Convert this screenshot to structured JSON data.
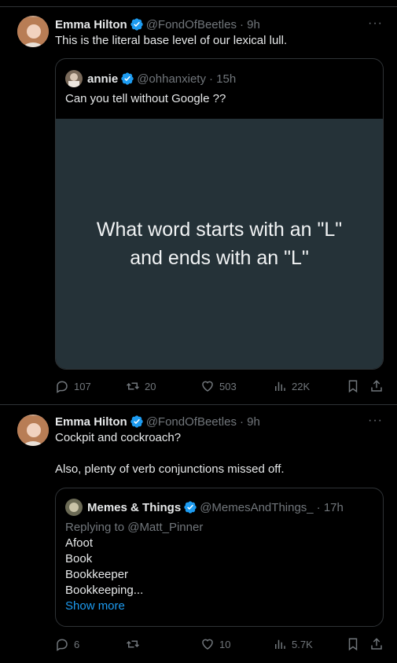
{
  "tweets": [
    {
      "author": {
        "name": "Emma Hilton",
        "handle": "@FondOfBeetles",
        "time": "· 9h"
      },
      "text": "This is the literal base level of our lexical lull.",
      "quote": {
        "author": {
          "name": "annie",
          "handle": "@ohhanxiety",
          "time": "· 15h"
        },
        "text": "Can you tell without Google ??",
        "media_text": "What word starts with an \"L\" and ends with an \"L\""
      },
      "actions": {
        "replies": "107",
        "reposts": "20",
        "likes": "503",
        "views": "22K"
      }
    },
    {
      "author": {
        "name": "Emma Hilton",
        "handle": "@FondOfBeetles",
        "time": "· 9h"
      },
      "text": "Cockpit and cockroach?\n\nAlso, plenty of verb conjunctions missed off.",
      "quote": {
        "author": {
          "name": "Memes & Things",
          "handle": "@MemesAndThings_",
          "time": "· 17h"
        },
        "replying_to": "Replying to @Matt_Pinner",
        "lines": [
          "Afoot",
          "Book",
          "Bookkeeper",
          "Bookkeeping..."
        ],
        "show_more": "Show more"
      },
      "actions": {
        "replies": "6",
        "reposts": "",
        "likes": "10",
        "views": "5.7K"
      }
    }
  ],
  "colors": {
    "background": "#000000",
    "border": "#2f3336",
    "muted": "#71767b",
    "accent": "#1d9bf0",
    "media_bg": "#253238"
  },
  "icons": [
    "verified-badge-icon",
    "more-icon",
    "reply-icon",
    "repost-icon",
    "like-icon",
    "views-icon",
    "bookmark-icon",
    "share-icon"
  ]
}
